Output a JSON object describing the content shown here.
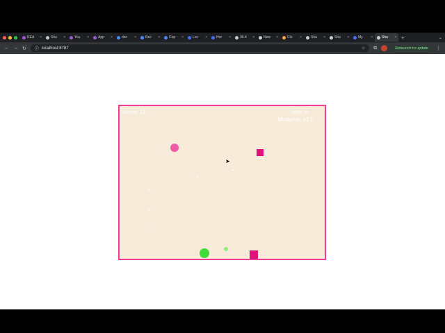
{
  "browser": {
    "tabs": [
      {
        "label": "REA",
        "icon": "purple-logo-icon",
        "color": "#9b59d0"
      },
      {
        "label": "Sha",
        "icon": "globe-icon",
        "color": "#c9cbd0"
      },
      {
        "label": "You",
        "icon": "purple-logo-icon",
        "color": "#9b59d0"
      },
      {
        "label": "App",
        "icon": "purple-logo-icon",
        "color": "#9b59d0"
      },
      {
        "label": "doc",
        "icon": "doc-icon",
        "color": "#4a8af4"
      },
      {
        "label": "Rec",
        "icon": "doc-icon",
        "color": "#4a8af4"
      },
      {
        "label": "Cop",
        "icon": "doc-icon",
        "color": "#4a8af4"
      },
      {
        "label": "Loc",
        "icon": "globe-icon",
        "color": "#4a6cf4"
      },
      {
        "label": "Hor",
        "icon": "globe-icon",
        "color": "#4a6cf4"
      },
      {
        "label": "36.4",
        "icon": "globe-icon",
        "color": "#c9cbd0"
      },
      {
        "label": "New",
        "icon": "gear-icon",
        "color": "#c9cbd0"
      },
      {
        "label": "Clo",
        "icon": "cloud-icon",
        "color": "#f4a340"
      },
      {
        "label": "Sha",
        "icon": "globe-icon",
        "color": "#c9cbd0"
      },
      {
        "label": "Sha",
        "icon": "globe-icon",
        "color": "#c9cbd0"
      },
      {
        "label": "My",
        "icon": "globe-icon",
        "color": "#4a6cf4"
      },
      {
        "label": "Sha",
        "icon": "globe-icon",
        "color": "#c9cbd0",
        "active": true
      }
    ],
    "url": "localhost:8787",
    "relaunch_label": "Relaunch to update"
  },
  "game": {
    "score_text": "Score: 11",
    "time_text": "Time: 6",
    "multiplier_text": "Multiplier: x1.0",
    "colors": {
      "border": "#ee3d96",
      "background": "#f7ead9",
      "player": "#3fdc3a",
      "enemy_square": "#e0117a",
      "pink_orb": "#ee5aa8",
      "green_orb": "#8ff07a"
    }
  }
}
